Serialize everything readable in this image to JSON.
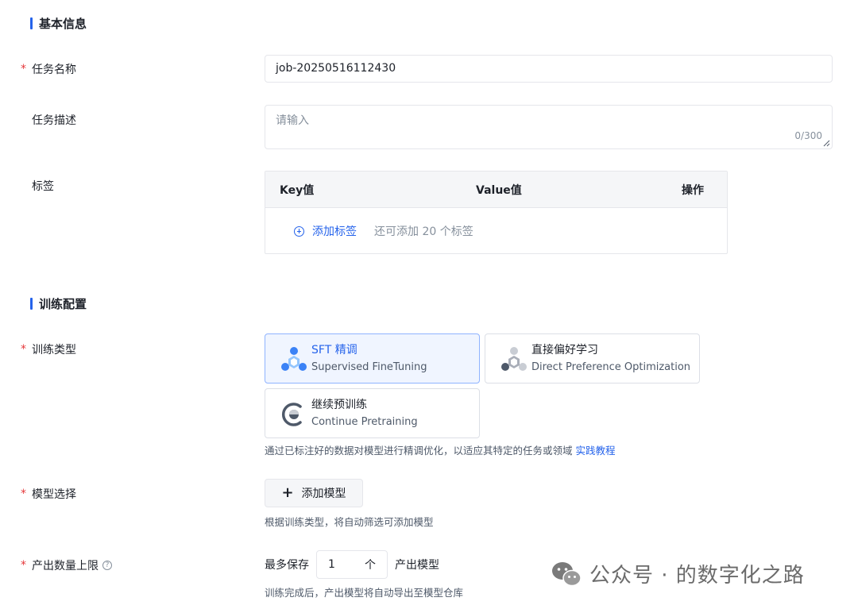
{
  "basic_info": {
    "section_title": "基本信息",
    "task_name": {
      "label": "任务名称",
      "required": "*",
      "value": "job-20250516112430"
    },
    "task_desc": {
      "label": "任务描述",
      "placeholder": "请输入",
      "count": "0/300"
    },
    "tags": {
      "label": "标签",
      "col_key": "Key值",
      "col_value": "Value值",
      "col_op": "操作",
      "add_label": "添加标签",
      "hint": "还可添加 20 个标签"
    }
  },
  "training_config": {
    "section_title": "训练配置",
    "train_type": {
      "label": "训练类型",
      "required": "*",
      "options": [
        {
          "title": "SFT 精调",
          "subtitle": "Supervised FineTuning",
          "icon": "sft-icon"
        },
        {
          "title": "直接偏好学习",
          "subtitle": "Direct Preference Optimization",
          "icon": "dpo-icon"
        },
        {
          "title": "继续预训练",
          "subtitle": "Continue Pretraining",
          "icon": "pretrain-icon"
        }
      ],
      "desc": "通过已标注好的数据对模型进行精调优化，以适应其特定的任务或领域",
      "desc_link": "实践教程"
    },
    "model_select": {
      "label": "模型选择",
      "required": "*",
      "button_label": "添加模型",
      "plus": "+",
      "desc": "根据训练类型，将自动筛选可添加模型"
    },
    "output_limit": {
      "label": "产出数量上限",
      "required": "*",
      "help": "?",
      "prefix": "最多保存",
      "value": "1",
      "unit": "个",
      "suffix": "产出模型",
      "desc": "训练完成后，产出模型将自动导出至模型仓库"
    }
  },
  "watermark": {
    "text": "公众号 · 的数字化之路",
    "icon": "wechat-icon"
  },
  "colors": {
    "accent": "#2563eb",
    "required": "#e5383b",
    "selected_bg": "#f0f5ff"
  }
}
